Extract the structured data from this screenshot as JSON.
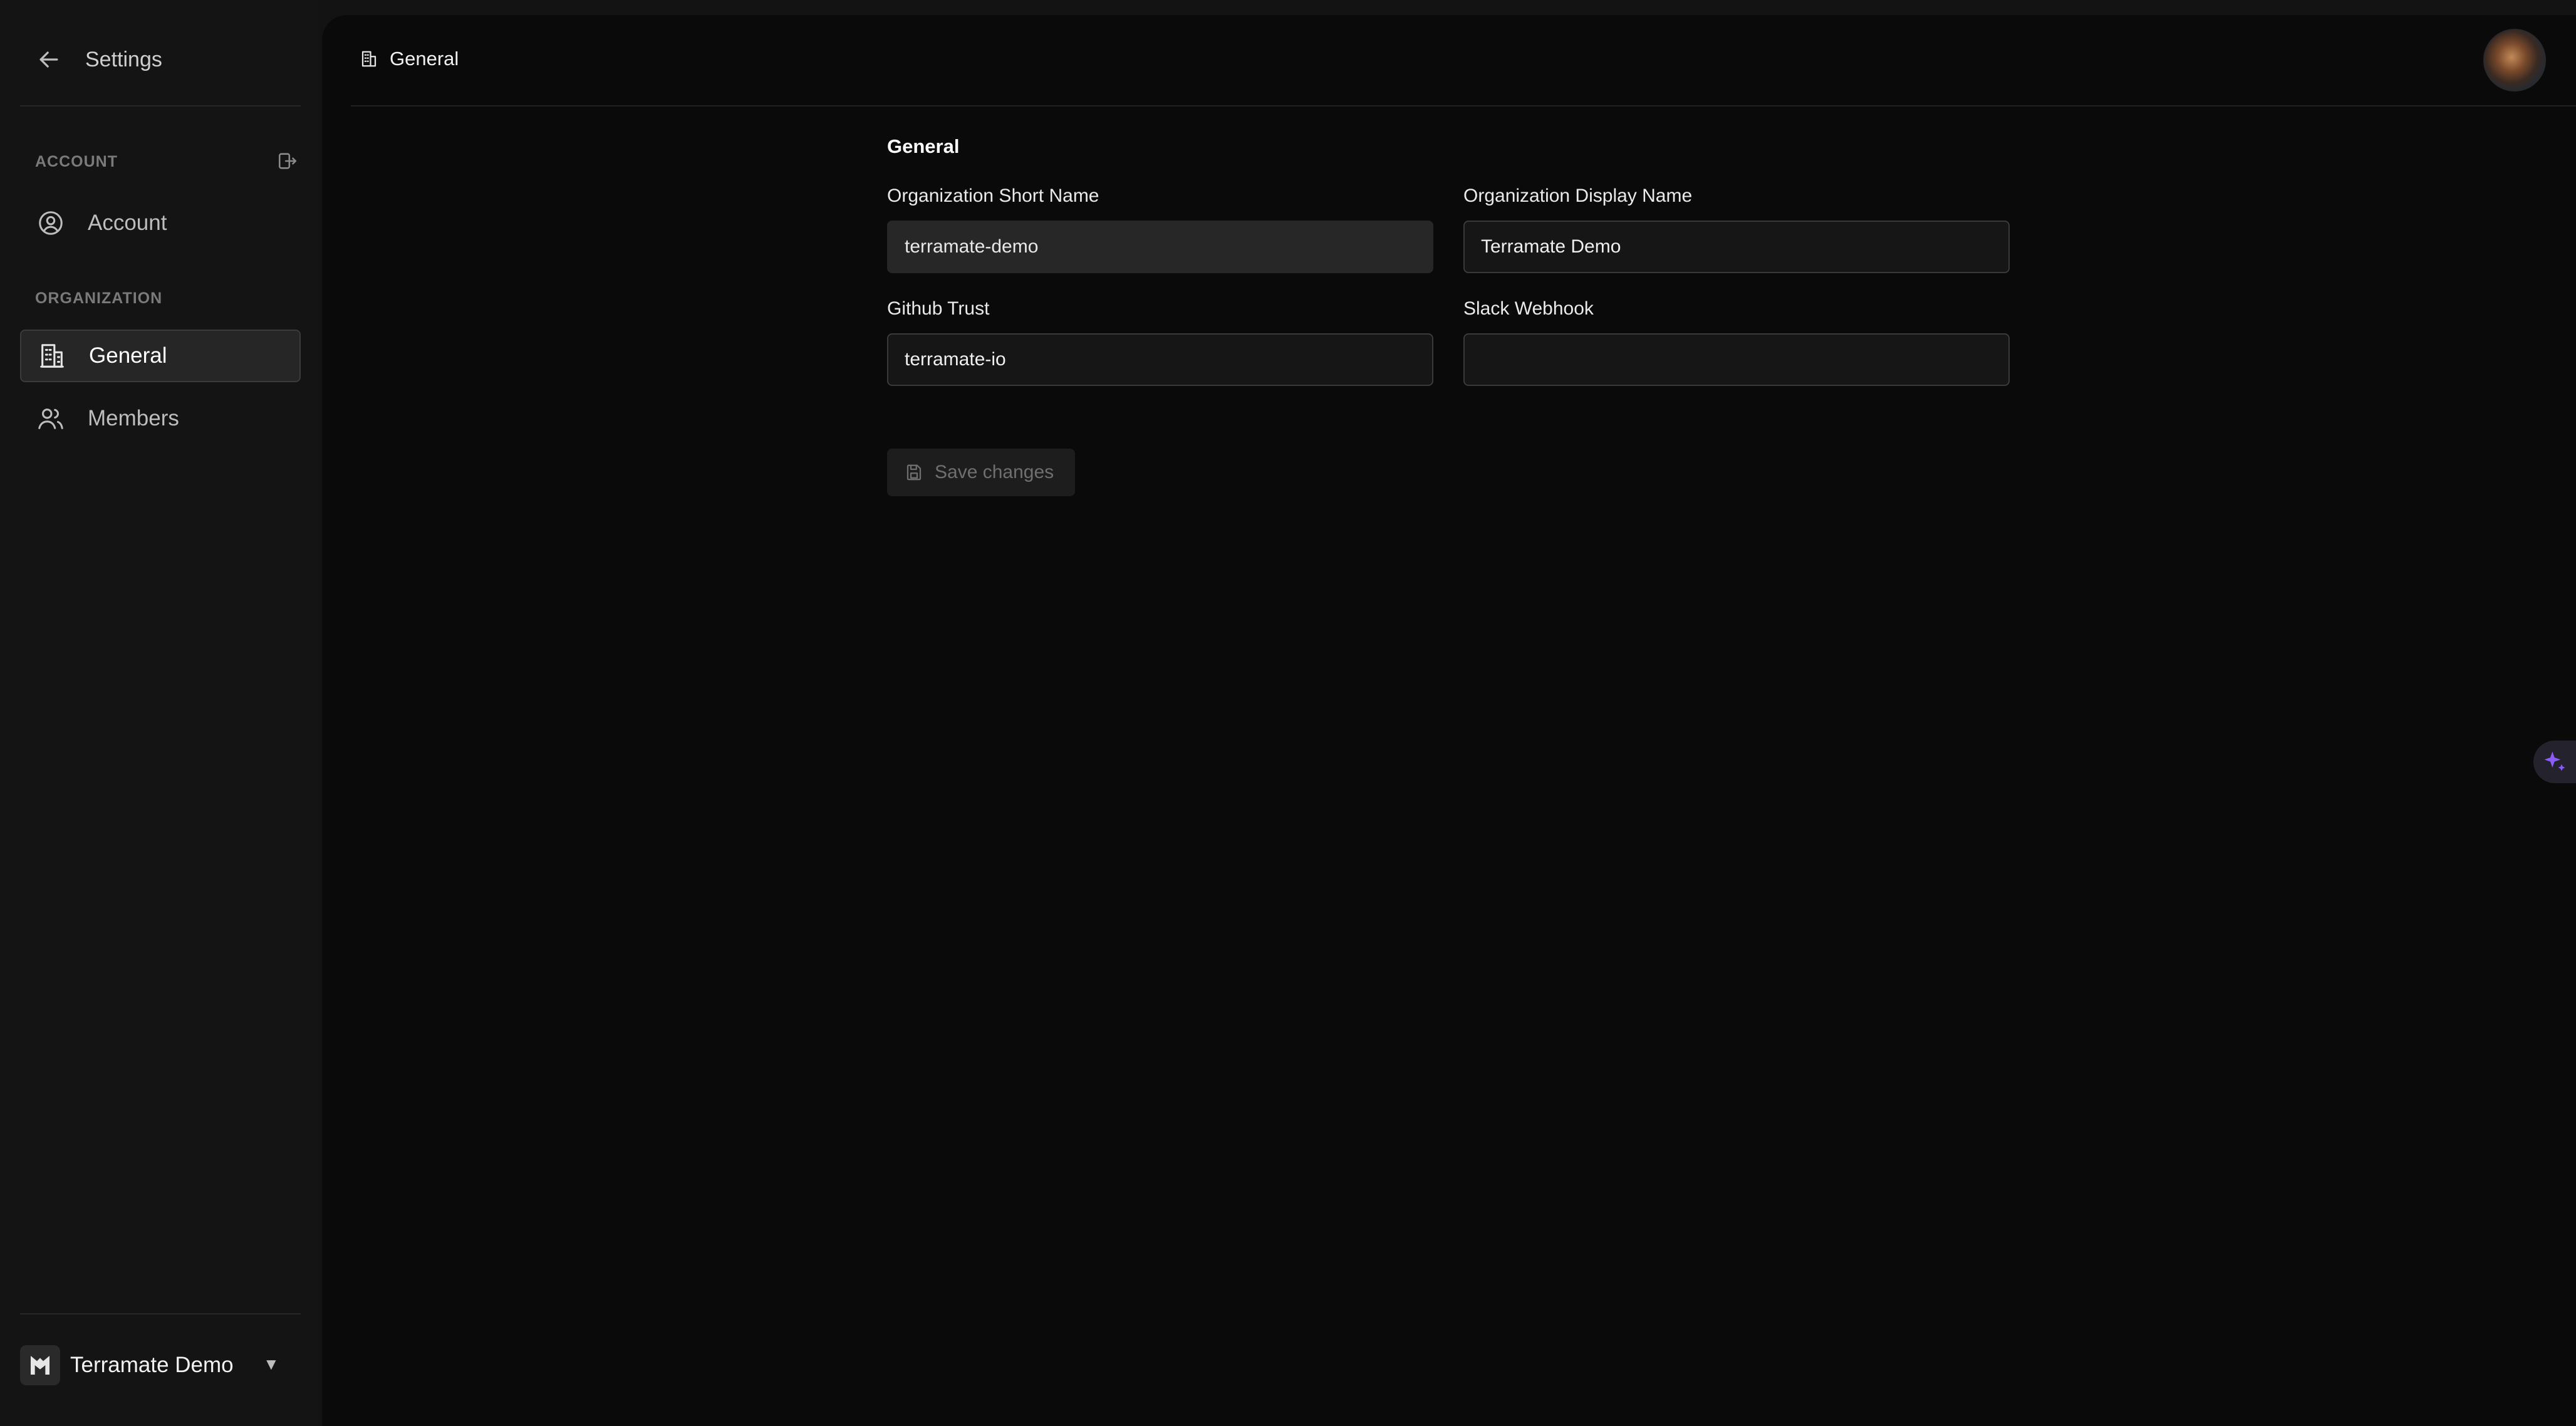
{
  "sidebar": {
    "title": "Settings",
    "account_section_label": "ACCOUNT",
    "organization_section_label": "ORGANIZATION",
    "items": [
      {
        "label": "Account",
        "icon": "user-circle-icon"
      },
      {
        "label": "General",
        "icon": "building-icon",
        "active": true
      },
      {
        "label": "Members",
        "icon": "users-icon"
      }
    ],
    "org_switcher": {
      "name": "Terramate Demo",
      "caret": "▼"
    }
  },
  "header": {
    "breadcrumb": "General"
  },
  "form": {
    "section_title": "General",
    "fields": [
      {
        "label": "Organization Short Name",
        "value": "terramate-demo",
        "disabled": true
      },
      {
        "label": "Organization Display Name",
        "value": "Terramate Demo"
      },
      {
        "label": "Github Trust",
        "value": "terramate-io"
      },
      {
        "label": "Slack Webhook",
        "value": ""
      }
    ],
    "save_label": "Save changes"
  },
  "colors": {
    "sidebar_bg": "#141414",
    "main_bg": "#0a0a0a",
    "active_item_bg": "#262626",
    "ai_accent": "#8b5cf6"
  }
}
